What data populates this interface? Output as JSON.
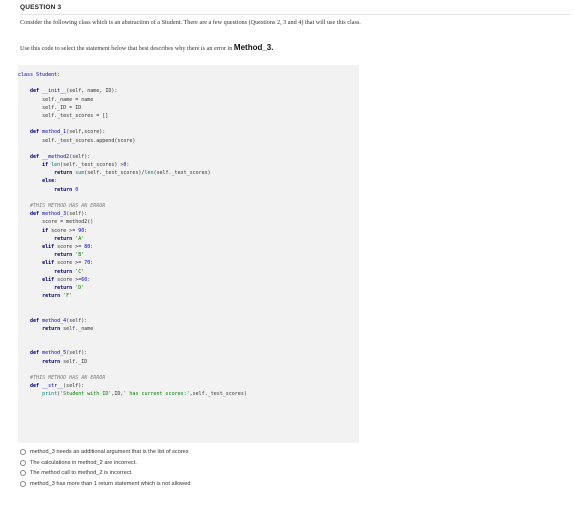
{
  "question": {
    "title": "QUESTION 3",
    "intro": "Consider the following class which is an abstraction of a Student. There are a few questions (Questions 2, 3 and 4) that will use this class.",
    "instruction_prefix": "Use this code to select the statement below that best describes why there is an error in ",
    "instruction_method": "Method_3."
  },
  "code_lines": [
    [
      {
        "t": "class Student:",
        "c": "cl"
      }
    ],
    [],
    [
      {
        "t": "    def ",
        "c": "kw"
      },
      {
        "t": "__init__",
        "c": "fn"
      },
      {
        "t": "(self, name, ID):"
      }
    ],
    [
      {
        "t": "        self._name = name"
      }
    ],
    [
      {
        "t": "        self._ID = ID"
      }
    ],
    [
      {
        "t": "        self._test_scores = []"
      }
    ],
    [],
    [
      {
        "t": "    def ",
        "c": "kw"
      },
      {
        "t": "method_1",
        "c": "fn"
      },
      {
        "t": "(self,score):"
      }
    ],
    [
      {
        "t": "        self._test_scores.append(score)"
      }
    ],
    [],
    [
      {
        "t": "    def ",
        "c": "kw"
      },
      {
        "t": "__method2",
        "c": "fn"
      },
      {
        "t": "(self):"
      }
    ],
    [
      {
        "t": "        if ",
        "c": "kw"
      },
      {
        "t": "len",
        "c": "bi"
      },
      {
        "t": "(self._test_scores) >"
      },
      {
        "t": "0",
        "c": "nm"
      },
      {
        "t": ":"
      }
    ],
    [
      {
        "t": "            return ",
        "c": "kw"
      },
      {
        "t": "sum",
        "c": "bi"
      },
      {
        "t": "(self._test_scores)/"
      },
      {
        "t": "len",
        "c": "bi"
      },
      {
        "t": "(self._test_scores)"
      }
    ],
    [
      {
        "t": "        else",
        "c": "kw"
      },
      {
        "t": ":"
      }
    ],
    [
      {
        "t": "            return ",
        "c": "kw"
      },
      {
        "t": "0",
        "c": "nm"
      }
    ],
    [],
    [
      {
        "t": "    #THIS METHOD HAS AN ERROR",
        "c": "cm"
      }
    ],
    [
      {
        "t": "    def ",
        "c": "kw"
      },
      {
        "t": "method_3",
        "c": "fn"
      },
      {
        "t": "(self):"
      }
    ],
    [
      {
        "t": "        score = method2()"
      }
    ],
    [
      {
        "t": "        if ",
        "c": "kw"
      },
      {
        "t": "score >= "
      },
      {
        "t": "90",
        "c": "nm"
      },
      {
        "t": ":"
      }
    ],
    [
      {
        "t": "            return ",
        "c": "kw"
      },
      {
        "t": "'A'",
        "c": "st"
      }
    ],
    [
      {
        "t": "        elif ",
        "c": "kw"
      },
      {
        "t": "score >= "
      },
      {
        "t": "80",
        "c": "nm"
      },
      {
        "t": ":"
      }
    ],
    [
      {
        "t": "            return ",
        "c": "kw"
      },
      {
        "t": "'B'",
        "c": "st"
      }
    ],
    [
      {
        "t": "        elif ",
        "c": "kw"
      },
      {
        "t": "score >= "
      },
      {
        "t": "70",
        "c": "nm"
      },
      {
        "t": ":"
      }
    ],
    [
      {
        "t": "            return ",
        "c": "kw"
      },
      {
        "t": "'C'",
        "c": "st"
      }
    ],
    [
      {
        "t": "        elif ",
        "c": "kw"
      },
      {
        "t": "score >="
      },
      {
        "t": "60",
        "c": "nm"
      },
      {
        "t": ":"
      }
    ],
    [
      {
        "t": "            return ",
        "c": "kw"
      },
      {
        "t": "'D'",
        "c": "st"
      }
    ],
    [
      {
        "t": "        return ",
        "c": "kw"
      },
      {
        "t": "'F'",
        "c": "st"
      }
    ],
    [],
    [],
    [
      {
        "t": "    def ",
        "c": "kw"
      },
      {
        "t": "method_4",
        "c": "fn"
      },
      {
        "t": "(self):"
      }
    ],
    [
      {
        "t": "        return ",
        "c": "kw"
      },
      {
        "t": "self._name"
      }
    ],
    [],
    [],
    [
      {
        "t": "    def ",
        "c": "kw"
      },
      {
        "t": "method_5",
        "c": "fn"
      },
      {
        "t": "(self):"
      }
    ],
    [
      {
        "t": "        return ",
        "c": "kw"
      },
      {
        "t": "self._ID"
      }
    ],
    [],
    [
      {
        "t": "    #THIS METHOD HAS AN ERROR",
        "c": "cm"
      }
    ],
    [
      {
        "t": "    def ",
        "c": "kw"
      },
      {
        "t": "__str__",
        "c": "fn"
      },
      {
        "t": "(self):"
      }
    ],
    [
      {
        "t": "        ",
        "c": ""
      },
      {
        "t": "print",
        "c": "bi"
      },
      {
        "t": "("
      },
      {
        "t": "'Student with ID'",
        "c": "st"
      },
      {
        "t": ",ID,"
      },
      {
        "t": "' has current scores:'",
        "c": "st"
      },
      {
        "t": ",self._test_scores)"
      }
    ]
  ],
  "options": [
    {
      "label": "method_3 needs an additional argument that is the list of scores"
    },
    {
      "label": "The calculations in method_2 are incorrect."
    },
    {
      "label": "The method call to method_2 is incorrect."
    },
    {
      "label": "method_3 has more than 1 return statement which is not allowed"
    }
  ]
}
